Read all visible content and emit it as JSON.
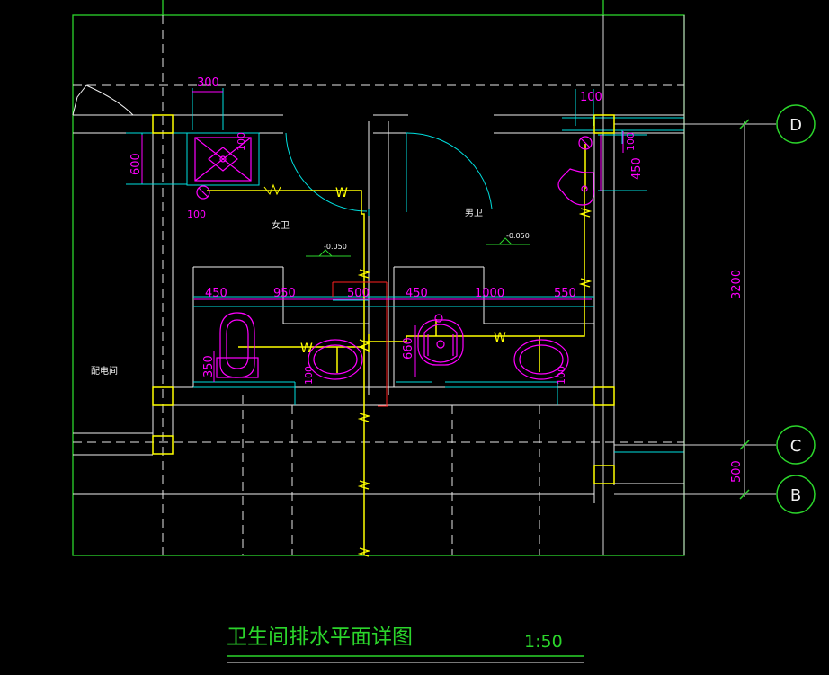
{
  "colors": {
    "background": "#000000",
    "frame": "#2bd52b",
    "wall": "#ffffff",
    "cyan": "#00e0e0",
    "magenta": "#ff00ff",
    "yellow": "#ffff00",
    "red": "#ff2020",
    "grid_line": "#d8d8d8"
  },
  "dimensions": {
    "top_300": "300",
    "top_100": "100",
    "left_600": "600",
    "left_100": "100",
    "small_100": "100",
    "right_100": "100",
    "right_450": "450",
    "row_450_left": "450",
    "row_950": "950",
    "row_500": "500",
    "row_450_right": "450",
    "row_1000": "1000",
    "row_550": "550",
    "v_350": "350",
    "v_100_left": "100",
    "v_660": "660",
    "v_100_right": "100",
    "axis_3200": "3200",
    "axis_500": "500"
  },
  "rooms": {
    "womens": "女卫",
    "mens": "男卫",
    "distribution": "配电间"
  },
  "levels": {
    "womens": "-0.050",
    "mens": "-0.050"
  },
  "pipe_labels": {
    "w1": "W",
    "w2": "W",
    "w3": "W"
  },
  "axes": {
    "d": "D",
    "c": "C",
    "b": "B"
  },
  "title": {
    "name": "卫生间排水平面详图",
    "scale": "1:50"
  }
}
